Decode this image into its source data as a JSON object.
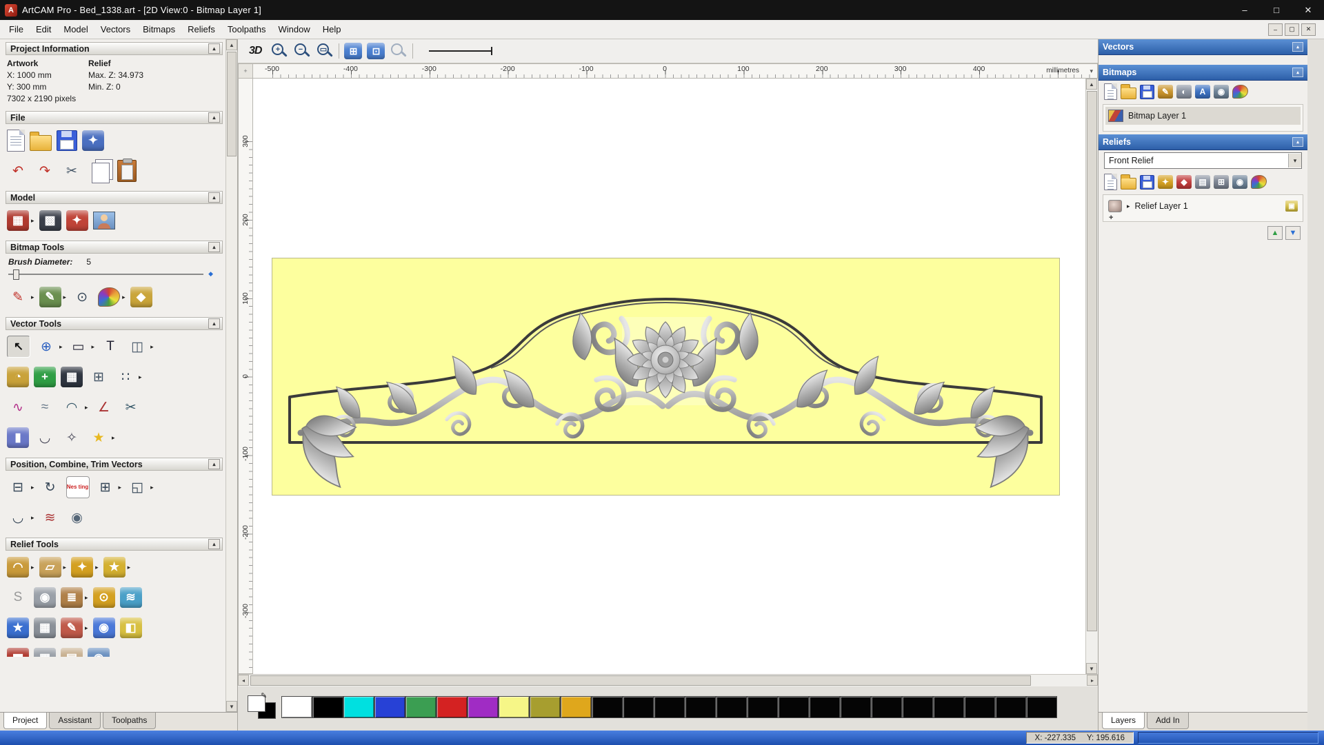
{
  "window": {
    "title": "ArtCAM Pro - Bed_1338.art - [2D View:0 - Bitmap Layer 1]",
    "controls": {
      "minimize": "–",
      "maximize": "□",
      "close": "✕"
    },
    "mdi": {
      "minimize": "–",
      "restore": "▢",
      "close": "✕"
    }
  },
  "menu": {
    "items": [
      "File",
      "Edit",
      "Model",
      "Vectors",
      "Bitmaps",
      "Reliefs",
      "Toolpaths",
      "Window",
      "Help"
    ]
  },
  "left_panel": {
    "project_information": {
      "title": "Project Information",
      "artwork_header": "Artwork",
      "relief_header": "Relief",
      "x": "X: 1000 mm",
      "y": "Y: 300 mm",
      "pixels": "7302 x 2190 pixels",
      "max_z": "Max. Z: 34.973",
      "min_z": "Min. Z: 0"
    },
    "section_titles": {
      "file": "File",
      "model": "Model",
      "bitmap_tools": "Bitmap Tools",
      "vector_tools": "Vector Tools",
      "position_combine_trim": "Position, Combine, Trim Vectors",
      "relief_tools": "Relief Tools"
    },
    "bitmap_tools": {
      "brush_diameter_label": "Brush Diameter:",
      "brush_diameter_value": "5"
    },
    "tabs": [
      "Project",
      "Assistant",
      "Toolpaths"
    ],
    "active_tab": "Project"
  },
  "view_toolbar": {
    "view_3d_label": "3D"
  },
  "rulers": {
    "h_labels": [
      "-500",
      "-400",
      "-300",
      "-200",
      "-100",
      "0",
      "100",
      "200",
      "300",
      "400"
    ],
    "v_labels": [
      "300",
      "200",
      "100",
      "0",
      "-100",
      "-200",
      "-300"
    ],
    "units_label": "millimetres"
  },
  "right_panel": {
    "vectors": {
      "title": "Vectors"
    },
    "bitmaps": {
      "title": "Bitmaps",
      "layers": [
        {
          "name": "Bitmap Layer 1"
        }
      ]
    },
    "reliefs": {
      "title": "Reliefs",
      "active_relief": "Front Relief",
      "layers": [
        {
          "name": "Relief Layer 1"
        }
      ]
    },
    "tabs": [
      "Layers",
      "Add In"
    ],
    "active_tab": "Layers"
  },
  "palette": {
    "swatches": [
      "#ffffff",
      "#000000",
      "#00e0e0",
      "#2741d6",
      "#3b9e52",
      "#d42222",
      "#a02cc4",
      "#f6f687",
      "#a79e2f",
      "#dfa71c",
      "#050505",
      "#050505",
      "#050505",
      "#050505",
      "#050505",
      "#050505",
      "#050505",
      "#050505",
      "#050505",
      "#050505",
      "#050505",
      "#050505",
      "#050505",
      "#050505",
      "#050505"
    ]
  },
  "status_bar": {
    "x_coord": "X: -227.335",
    "y_coord": "Y: 195.616"
  },
  "icons": {
    "app": {
      "g": "A"
    },
    "flyout": {
      "g": "▸",
      "f": "#222222"
    },
    "rollup": {
      "g": "▴",
      "f": "#333333"
    },
    "header_pin": {
      "g": "▴",
      "f": "#ffffff"
    },
    "corner": {
      "g": "+",
      "f": "#777777"
    },
    "ruler_menu": {
      "g": "▾",
      "f": "#555555"
    },
    "dropdown_arrow": {
      "g": "▾",
      "f": "#333333"
    },
    "scroll_up": {
      "g": "▲"
    },
    "scroll_down": {
      "g": "▼"
    },
    "scroll_left": {
      "g": "◂"
    },
    "scroll_right": {
      "g": "▸"
    },
    "import_model": {
      "g": "✦",
      "c": "#4a6fc0"
    },
    "undo": {
      "g": "↶",
      "f": "#c03028"
    },
    "redo": {
      "g": "↷",
      "f": "#c03028"
    },
    "cut": {
      "g": "✂",
      "f": "#445566"
    },
    "model_dimensions": {
      "g": "▦",
      "c": "#b03a30"
    },
    "model_dark": {
      "g": "▩",
      "c": "#3a3f4a"
    },
    "model_lighting": {
      "g": "✦",
      "c": "#c04438"
    },
    "paint_brush": {
      "g": "✎",
      "f": "#c03028"
    },
    "paint_vector": {
      "g": "✎",
      "c": "#6a8f4f"
    },
    "dropper": {
      "g": "⊙",
      "f": "#334455"
    },
    "flood_fill": {
      "g": "◆",
      "c": "#caa53a"
    },
    "select": {
      "g": "↖",
      "f": "#111111"
    },
    "transform": {
      "g": "⊕",
      "f": "#2a5fc0"
    },
    "rectangle": {
      "g": "▭",
      "f": "#222233"
    },
    "text": {
      "g": "T",
      "f": "#222233"
    },
    "mirror": {
      "g": "◫",
      "f": "#445566"
    },
    "measure": {
      "g": "◔",
      "c": "#c9a23a"
    },
    "snap_add": {
      "g": "+",
      "c": "#2f9e44"
    },
    "bitmap_to_vector": {
      "g": "▦",
      "c": "#2f3540"
    },
    "grid": {
      "g": "⊞",
      "f": "#445566"
    },
    "paste_array": {
      "g": "∷",
      "f": "#334455"
    },
    "spline": {
      "g": "∿",
      "f": "#b3308a"
    },
    "smooth": {
      "g": "≈",
      "f": "#667788"
    },
    "node_arc": {
      "g": "◠",
      "f": "#335566"
    },
    "polyline": {
      "g": "∠",
      "f": "#aa3333"
    },
    "trim_node": {
      "g": "✂",
      "f": "#335566"
    },
    "cylinder": {
      "g": "▮",
      "c": "#6a78c8"
    },
    "arc": {
      "g": "◡",
      "f": "#444455"
    },
    "node_edit": {
      "g": "✧",
      "f": "#444455"
    },
    "star": {
      "g": "★",
      "f": "#e8b820"
    },
    "align": {
      "g": "⊟",
      "f": "#334455"
    },
    "rotate_array": {
      "g": "↻",
      "f": "#334455"
    },
    "nesting": {
      "g": "Nes ting"
    },
    "block_array": {
      "g": "⊞",
      "f": "#334455"
    },
    "weld": {
      "g": "◱",
      "f": "#334455"
    },
    "arc_fit": {
      "g": "◡",
      "f": "#334455"
    },
    "trim_vectors": {
      "g": "≋",
      "f": "#aa3333"
    },
    "spiral": {
      "g": "◉",
      "f": "#556677"
    },
    "relief_smooth": {
      "g": "◠",
      "c": "#c99a3a"
    },
    "relief_sand": {
      "g": "▱",
      "c": "#c9a25a"
    },
    "relief_emboss": {
      "g": "✦",
      "c": "#d4a020"
    },
    "relief_star": {
      "g": "★",
      "c": "#d4b030"
    },
    "relief_s": {
      "g": "S",
      "f": "#999999"
    },
    "relief_weave_sphere": {
      "g": "◉",
      "c": "#9aa0a8"
    },
    "relief_layers": {
      "g": "≣",
      "c": "#b08048"
    },
    "relief_pin": {
      "g": "⊙",
      "c": "#d4a020"
    },
    "relief_wave": {
      "g": "≋",
      "c": "#4aa0c8"
    },
    "relief_star_blue": {
      "g": "★",
      "c": "#3a6fd0"
    },
    "relief_texture": {
      "g": "▦",
      "c": "#8a9098"
    },
    "relief_paint": {
      "g": "✎",
      "c": "#c05a4a"
    },
    "relief_sphere": {
      "g": "◉",
      "c": "#4a78d8"
    },
    "relief_layer_add": {
      "g": "◧",
      "c": "#d8c040"
    },
    "relief_partial_1": {
      "g": "▆",
      "c": "#b03a30"
    },
    "relief_partial_2": {
      "g": "▦",
      "c": "#9aa0a8"
    },
    "relief_partial_3": {
      "g": "▤",
      "c": "#c8b090"
    },
    "relief_partial_4": {
      "g": "◉",
      "c": "#6a90c0"
    },
    "zoom_in": {
      "g": "+"
    },
    "zoom_out": {
      "g": "−"
    },
    "zoom_fit": {
      "g": "▭"
    },
    "zoom_prev": {
      "g": ""
    },
    "view_pan1": {
      "g": "⊞",
      "c": "#4a7fd0"
    },
    "view_pan2": {
      "g": "⊡",
      "c": "#4a7fd0"
    },
    "rp_brush": {
      "g": "✎",
      "c": "#c9932a"
    },
    "rp_contrast": {
      "g": "◐",
      "c": "#8a92a0"
    },
    "rp_abc": {
      "g": "A",
      "c": "#3a6fc0"
    },
    "rp_sphere": {
      "g": "◉",
      "c": "#6a7f94"
    },
    "rp_gem": {
      "g": "◆",
      "c": "#c03a3a"
    },
    "rp_lamp": {
      "g": "✦",
      "c": "#d4a020"
    },
    "rp_sheet": {
      "g": "▤",
      "c": "#8a92a0"
    },
    "rp_calc": {
      "g": "⊞",
      "c": "#7a8290"
    },
    "layer_up": {
      "g": "▲",
      "f": "#2f9e44"
    },
    "layer_down": {
      "g": "▼",
      "f": "#2a6fd4"
    },
    "relief_visible": {
      "g": "▣",
      "c": "#d8c040"
    },
    "expander": {
      "g": "▸",
      "f": "#222222"
    },
    "plus_small": {
      "g": "+",
      "f": "#333333"
    },
    "brush_marker": {
      "g": "◆",
      "f": "#2a6fd4"
    },
    "pen_indicator": {
      "g": "✎",
      "f": "#333333"
    }
  }
}
